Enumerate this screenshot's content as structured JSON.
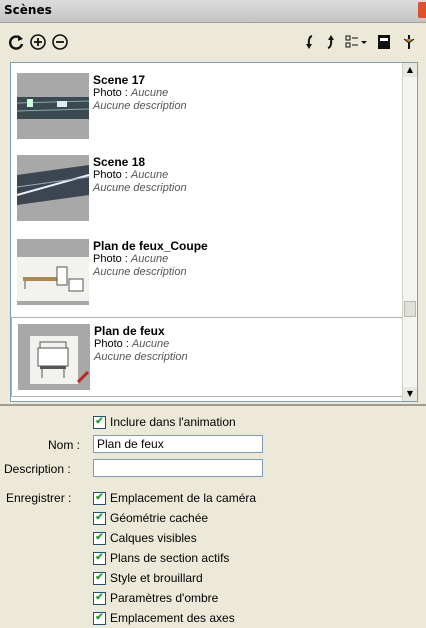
{
  "panel": {
    "title": "Scènes"
  },
  "toolbar": {
    "refresh_icon": "refresh-icon",
    "add_icon": "add-scene-icon",
    "remove_icon": "remove-scene-icon",
    "move_down_icon": "move-down-icon",
    "move_up_icon": "move-up-icon",
    "view_options_icon": "view-options-icon",
    "details_icon": "details-icon"
  },
  "scenes": [
    {
      "name": "Scene 17",
      "photo_label": "Photo :",
      "photo_value": "Aucune",
      "description": "Aucune description",
      "selected": false
    },
    {
      "name": "Scene 18",
      "photo_label": "Photo :",
      "photo_value": "Aucune",
      "description": "Aucune description",
      "selected": false
    },
    {
      "name": "Plan de feux_Coupe",
      "photo_label": "Photo :",
      "photo_value": "Aucune",
      "description": "Aucune description",
      "selected": false
    },
    {
      "name": "Plan de feux",
      "photo_label": "Photo :",
      "photo_value": "Aucune",
      "description": "Aucune description",
      "selected": true
    }
  ],
  "form": {
    "include_animation": {
      "label": "Inclure dans l'animation",
      "checked": true
    },
    "name_label": "Nom :",
    "name_value": "Plan de feux",
    "description_label": "Description :",
    "description_value": "",
    "save_label": "Enregistrer :",
    "save_options": [
      {
        "label": "Emplacement de la caméra",
        "checked": true
      },
      {
        "label": "Géométrie cachée",
        "checked": true
      },
      {
        "label": "Calques visibles",
        "checked": true
      },
      {
        "label": "Plans de section actifs",
        "checked": true
      },
      {
        "label": "Style et brouillard",
        "checked": true
      },
      {
        "label": "Paramètres d'ombre",
        "checked": true
      },
      {
        "label": "Emplacement des axes",
        "checked": true
      }
    ]
  }
}
